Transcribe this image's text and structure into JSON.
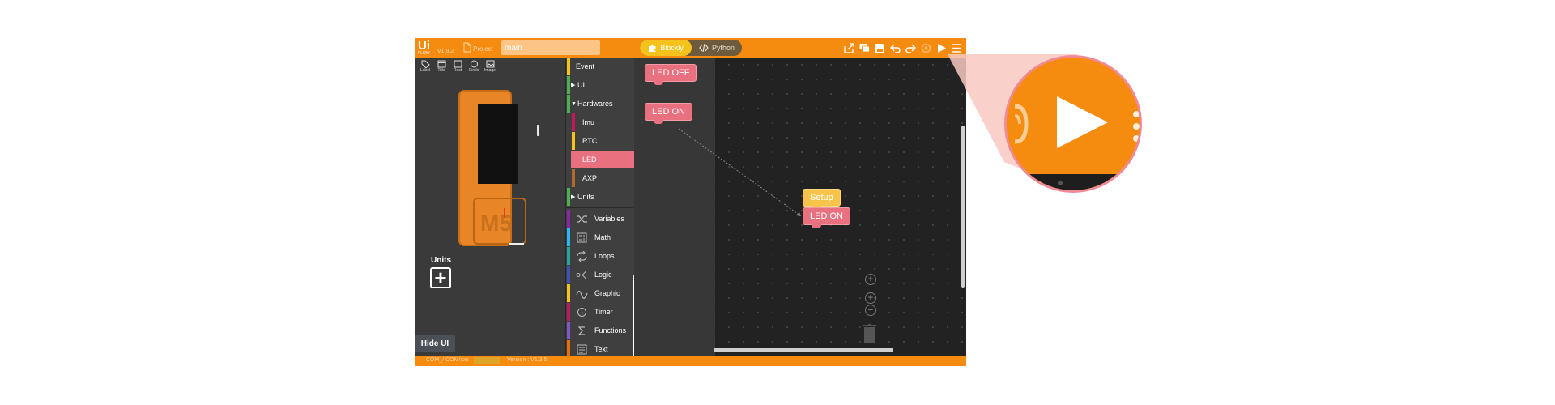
{
  "app": {
    "logo": "Ui",
    "logo_sub": "FLOW",
    "version": "V1.9.2",
    "project_label": "Project",
    "filename_value": "main",
    "mode_blockly": "Blockly",
    "mode_python": "Python",
    "toolbar_icons": [
      "share-icon",
      "comment-icon",
      "save-icon",
      "undo-icon",
      "redo-icon",
      "refresh-icon",
      "run-icon",
      "menu-icon"
    ]
  },
  "left_panel": {
    "tools": [
      "Label",
      "Title",
      "Rect",
      "Circle",
      "Image"
    ],
    "device_logo": "M5",
    "units_label": "Units",
    "units_add": "+",
    "hide_ui": "Hide UI"
  },
  "toolbox": {
    "categories": [
      {
        "label": "Event",
        "color": "#f5c21b"
      },
      {
        "label": "UI",
        "color": "#4caf50",
        "arrow": "▶"
      },
      {
        "label": "Hardwares",
        "color": "#4caf50",
        "arrow": "▼"
      },
      {
        "label": "Imu",
        "color": "#c2185b"
      },
      {
        "label": "RTC",
        "color": "#f5c21b"
      },
      {
        "label": "LED",
        "color": "#e9707f"
      },
      {
        "label": "AXP",
        "color": "#b06a2a"
      },
      {
        "label": "Units",
        "color": "#4caf50",
        "arrow": "▶"
      },
      {
        "label": "Variables",
        "color": "#8e24aa"
      },
      {
        "label": "Math",
        "color": "#29b6f6"
      },
      {
        "label": "Loops",
        "color": "#26a69a"
      },
      {
        "label": "Logic",
        "color": "#3f51b5"
      },
      {
        "label": "Graphic",
        "color": "#f5c21b"
      },
      {
        "label": "Timer",
        "color": "#c2185b"
      },
      {
        "label": "Functions",
        "color": "#7e57c2"
      },
      {
        "label": "Text",
        "color": "#ef6c00"
      }
    ]
  },
  "workspace": {
    "flyout_blocks": [
      "LED OFF",
      "LED ON"
    ],
    "setup_block": "Setup",
    "setup_child": "LED ON",
    "zoom_in": "+",
    "zoom_reset": "+",
    "zoom_out": "−"
  },
  "statusbar": {
    "port": "COM_/ COM/xxx",
    "version": "Version : V1.3.5"
  },
  "colors": {
    "accent": "#f58b0f",
    "led_block": "#e9707f",
    "setup_block": "#f7c44b",
    "callout_border": "#f08a97"
  }
}
